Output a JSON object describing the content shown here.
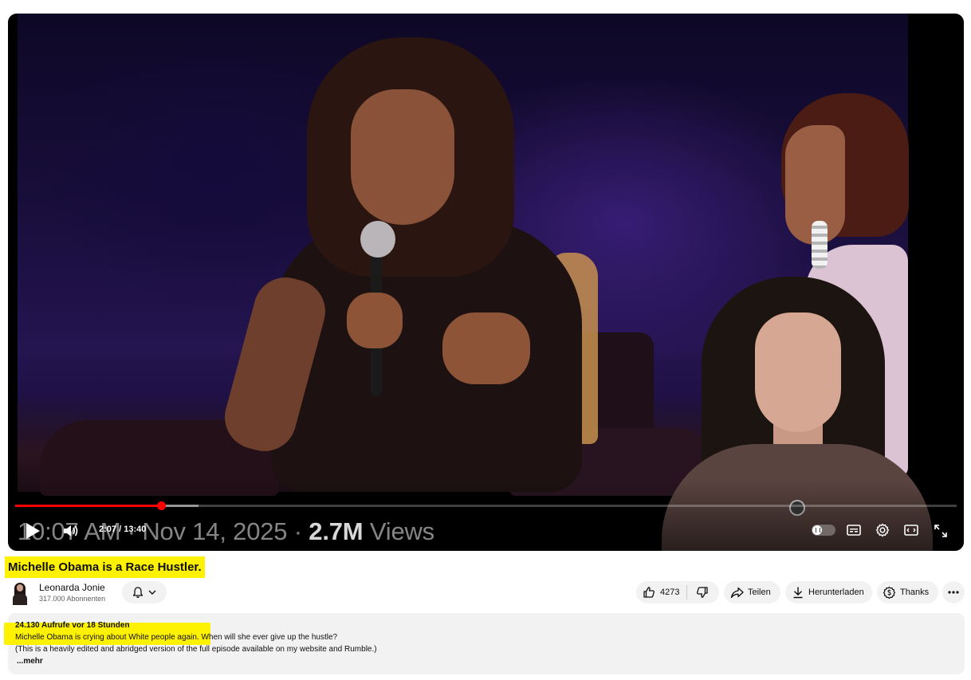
{
  "player": {
    "overlay_time": "10:07 AM · Nov 14, 2025 · ",
    "overlay_views": "2.7M",
    "overlay_views_suffix": " Views",
    "time_current": "2:07",
    "time_separator": " / ",
    "time_total": "13:40",
    "progress_played": 0.155,
    "progress_buffered": 0.195,
    "icons": [
      "play-icon",
      "volume-icon",
      "autoplay-toggle",
      "subtitles-icon",
      "settings-icon",
      "theater-mode-icon",
      "fullscreen-icon"
    ]
  },
  "video": {
    "title": "Michelle Obama is a Race Hustler."
  },
  "channel": {
    "name": "Leonarda Jonie",
    "subscribers": "317.000 Abonnenten"
  },
  "actions": {
    "like_count": "4273",
    "share_label": "Teilen",
    "download_label": "Herunterladen",
    "thanks_label": "Thanks"
  },
  "description": {
    "meta": "24.130 Aufrufe  vor 18 Stunden",
    "line1": "Michelle Obama is crying about White people again. When will she ever give up the hustle?",
    "line2": "(This is a heavily edited and abridged version of the full episode available on my website and Rumble.)",
    "more": "...mehr"
  },
  "colors": {
    "highlight": "#fff200",
    "progress": "#ff0000",
    "pill_bg": "#f2f2f2"
  }
}
